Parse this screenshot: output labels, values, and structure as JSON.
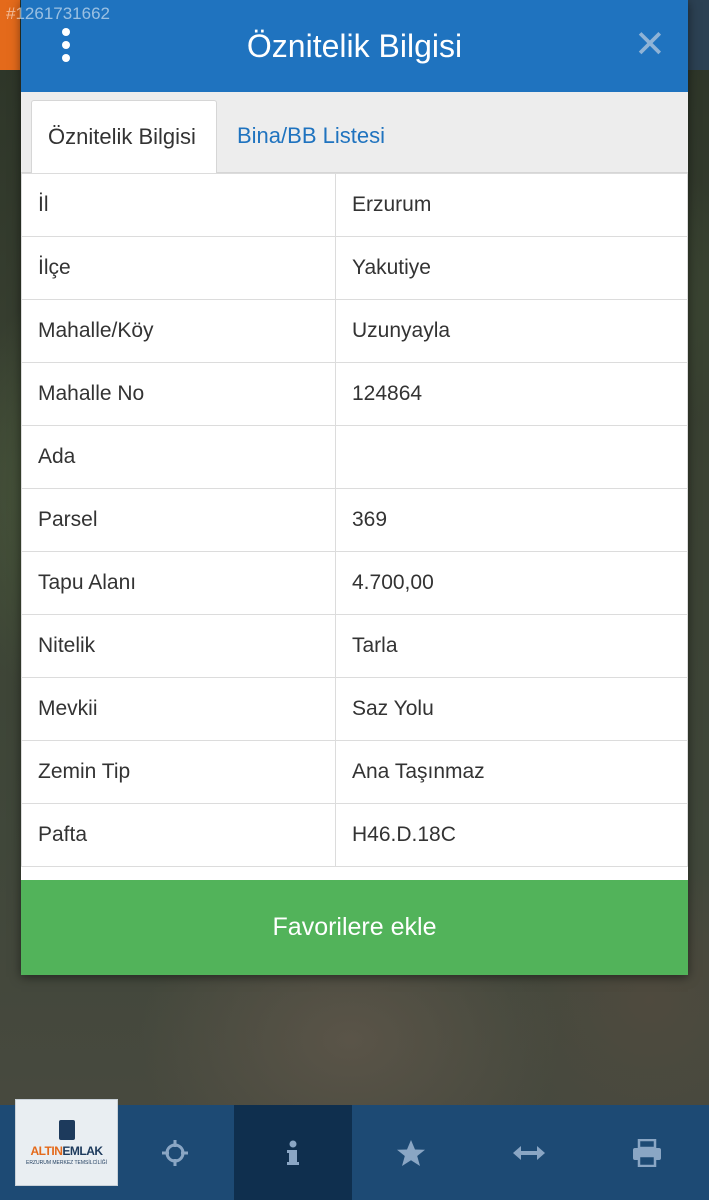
{
  "watermark": "#1261731662",
  "dialog": {
    "title": "Öznitelik Bilgisi",
    "tabs": [
      {
        "label": "Öznitelik Bilgisi",
        "active": true
      },
      {
        "label": "Bina/BB Listesi",
        "active": false
      }
    ],
    "rows": [
      {
        "key": "İl",
        "value": "Erzurum"
      },
      {
        "key": "İlçe",
        "value": "Yakutiye"
      },
      {
        "key": "Mahalle/Köy",
        "value": "Uzunyayla"
      },
      {
        "key": "Mahalle No",
        "value": "124864"
      },
      {
        "key": "Ada",
        "value": ""
      },
      {
        "key": "Parsel",
        "value": "369"
      },
      {
        "key": "Tapu Alanı",
        "value": "4.700,00"
      },
      {
        "key": "Nitelik",
        "value": "Tarla"
      },
      {
        "key": "Mevkii",
        "value": "Saz Yolu"
      },
      {
        "key": "Zemin Tip",
        "value": "Ana Taşınmaz"
      },
      {
        "key": "Pafta",
        "value": "H46.D.18C"
      }
    ],
    "favorite_button": "Favorilere ekle"
  },
  "logo": {
    "brand_left": "ALTIN",
    "brand_right": "EMLAK",
    "subtitle": "ERZURUM MERKEZ TEMSİLCİLİĞİ"
  },
  "bottom_nav": [
    {
      "icon": "crosshair-icon"
    },
    {
      "icon": "info-icon",
      "active": true
    },
    {
      "icon": "star-icon"
    },
    {
      "icon": "horizontal-arrows-icon"
    },
    {
      "icon": "print-icon"
    }
  ],
  "colors": {
    "header": "#1f73bf",
    "favorite_button": "#52b35a",
    "bottom_bar": "#1d4a74",
    "bottom_bar_active": "#0f2f4e",
    "tab_link": "#1f73bf"
  }
}
